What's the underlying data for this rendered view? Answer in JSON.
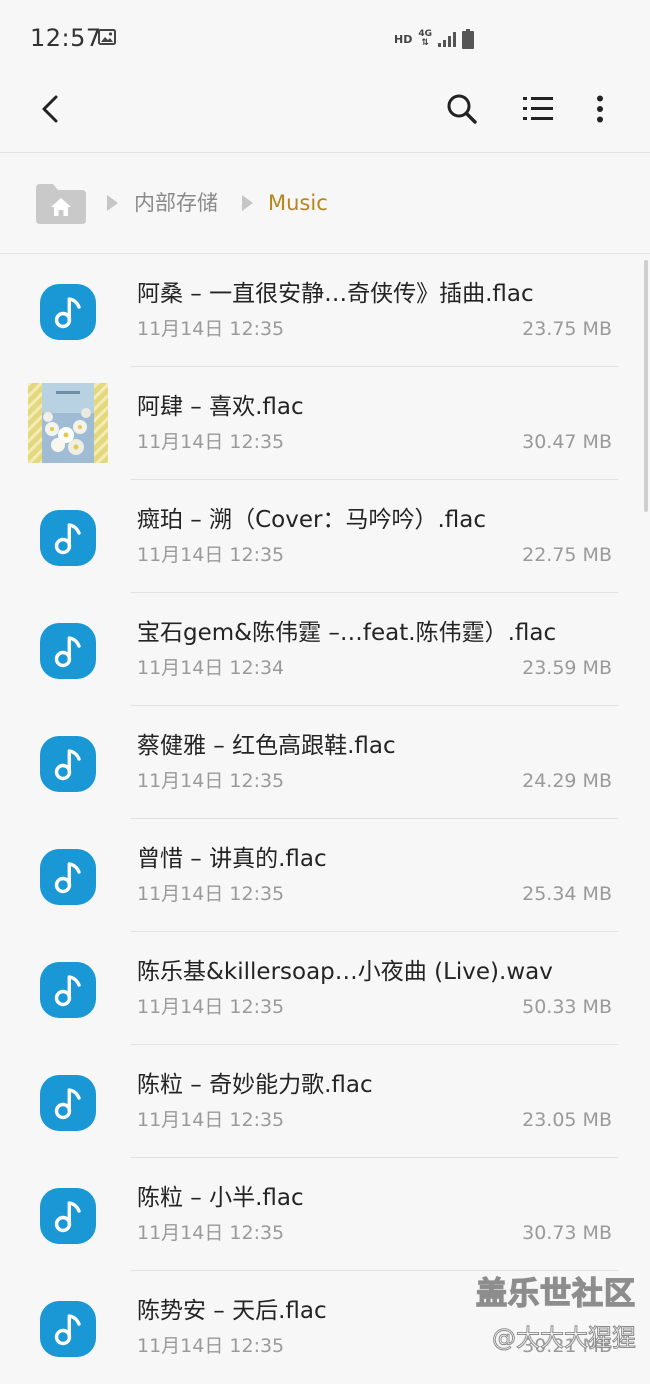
{
  "status_bar": {
    "time": "12:57",
    "hd_label": "HD",
    "network_label": "4G",
    "icons": [
      "gallery-icon",
      "signal-icon",
      "battery-icon"
    ]
  },
  "toolbar": {
    "icons": [
      "back-arrow-icon",
      "search-icon",
      "list-view-icon",
      "more-options-icon"
    ]
  },
  "breadcrumb": {
    "items": [
      "内部存储",
      "Music"
    ],
    "icons": [
      "home-folder-icon",
      "chevron-right-icon"
    ],
    "accent_color": "#b5861c"
  },
  "files": [
    {
      "name": "阿桑 – 一直很安静…奇侠传》插曲.flac",
      "date": "11月14日 12:35",
      "size": "23.75 MB",
      "icon": "music-note-icon"
    },
    {
      "name": "阿肆 – 喜欢.flac",
      "date": "11月14日 12:35",
      "size": "30.47 MB",
      "icon": "album-thumbnail"
    },
    {
      "name": "癍珀 – 溯（Cover：马吟吟）.flac",
      "date": "11月14日 12:35",
      "size": "22.75 MB",
      "icon": "music-note-icon"
    },
    {
      "name": "宝石gem&陈伟霆 –…feat.陈伟霆）.flac",
      "date": "11月14日 12:34",
      "size": "23.59 MB",
      "icon": "music-note-icon"
    },
    {
      "name": "蔡健雅 – 红色高跟鞋.flac",
      "date": "11月14日 12:35",
      "size": "24.29 MB",
      "icon": "music-note-icon"
    },
    {
      "name": "曾惜 – 讲真的.flac",
      "date": "11月14日 12:35",
      "size": "25.34 MB",
      "icon": "music-note-icon"
    },
    {
      "name": "陈乐基&killersoap…小夜曲 (Live).wav",
      "date": "11月14日 12:35",
      "size": "50.33 MB",
      "icon": "music-note-icon"
    },
    {
      "name": "陈粒 – 奇妙能力歌.flac",
      "date": "11月14日 12:35",
      "size": "23.05 MB",
      "icon": "music-note-icon"
    },
    {
      "name": "陈粒 – 小半.flac",
      "date": "11月14日 12:35",
      "size": "30.73 MB",
      "icon": "music-note-icon"
    },
    {
      "name": "陈势安 – 天后.flac",
      "date": "11月14日 12:35",
      "size": "30.21 MB",
      "icon": "music-note-icon"
    }
  ],
  "watermark": {
    "title": "盖乐世社区",
    "subtitle": "@大大大猩猩"
  },
  "colors": {
    "background": "#f7f7f7",
    "music_icon": "#1a98d5",
    "secondary_text": "#9a9a9a"
  }
}
